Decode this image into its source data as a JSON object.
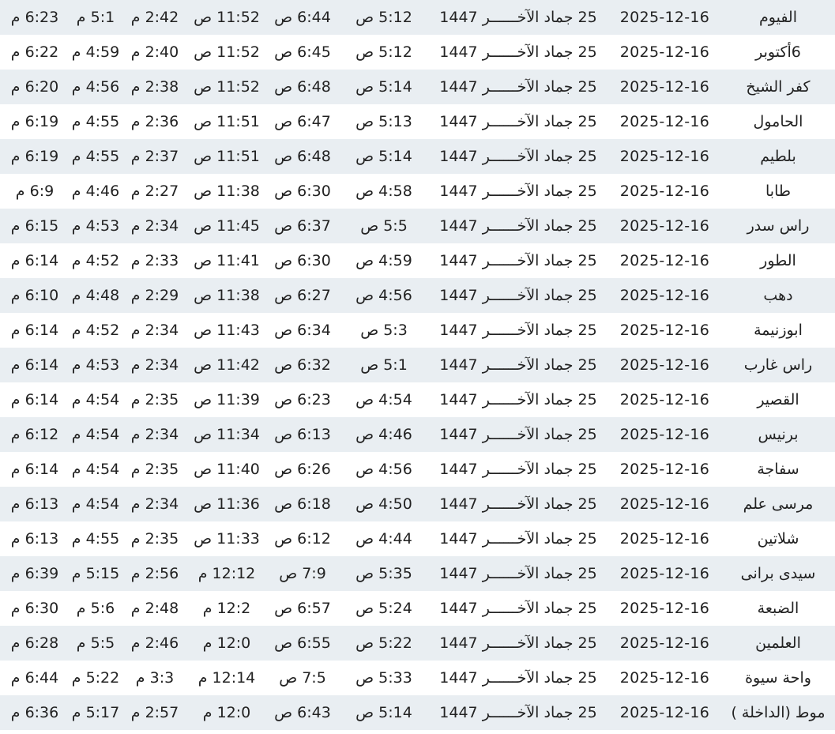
{
  "rows": [
    {
      "city": "الفيوم",
      "gregorian": "2025-12-16",
      "hijri": "25 جماد الآخــــــر 1447",
      "fajr": "5:12 ص",
      "sunrise": "6:44 ص",
      "dhuhr": "11:52 ص",
      "asr": "2:42 م",
      "maghrib": "5:1 م",
      "isha": "6:23 م"
    },
    {
      "city": "6أكتوبر",
      "gregorian": "2025-12-16",
      "hijri": "25 جماد الآخــــــر 1447",
      "fajr": "5:12 ص",
      "sunrise": "6:45 ص",
      "dhuhr": "11:52 ص",
      "asr": "2:40 م",
      "maghrib": "4:59 م",
      "isha": "6:22 م"
    },
    {
      "city": "كفر الشيخ",
      "gregorian": "2025-12-16",
      "hijri": "25 جماد الآخــــــر 1447",
      "fajr": "5:14 ص",
      "sunrise": "6:48 ص",
      "dhuhr": "11:52 ص",
      "asr": "2:38 م",
      "maghrib": "4:56 م",
      "isha": "6:20 م"
    },
    {
      "city": "الحامول",
      "gregorian": "2025-12-16",
      "hijri": "25 جماد الآخــــــر 1447",
      "fajr": "5:13 ص",
      "sunrise": "6:47 ص",
      "dhuhr": "11:51 ص",
      "asr": "2:36 م",
      "maghrib": "4:55 م",
      "isha": "6:19 م"
    },
    {
      "city": "بلطيم",
      "gregorian": "2025-12-16",
      "hijri": "25 جماد الآخــــــر 1447",
      "fajr": "5:14 ص",
      "sunrise": "6:48 ص",
      "dhuhr": "11:51 ص",
      "asr": "2:37 م",
      "maghrib": "4:55 م",
      "isha": "6:19 م"
    },
    {
      "city": "طابا",
      "gregorian": "2025-12-16",
      "hijri": "25 جماد الآخــــــر 1447",
      "fajr": "4:58 ص",
      "sunrise": "6:30 ص",
      "dhuhr": "11:38 ص",
      "asr": "2:27 م",
      "maghrib": "4:46 م",
      "isha": "6:9 م"
    },
    {
      "city": "راس سدر",
      "gregorian": "2025-12-16",
      "hijri": "25 جماد الآخــــــر 1447",
      "fajr": "5:5 ص",
      "sunrise": "6:37 ص",
      "dhuhr": "11:45 ص",
      "asr": "2:34 م",
      "maghrib": "4:53 م",
      "isha": "6:15 م"
    },
    {
      "city": "الطور",
      "gregorian": "2025-12-16",
      "hijri": "25 جماد الآخــــــر 1447",
      "fajr": "4:59 ص",
      "sunrise": "6:30 ص",
      "dhuhr": "11:41 ص",
      "asr": "2:33 م",
      "maghrib": "4:52 م",
      "isha": "6:14 م"
    },
    {
      "city": "دهب",
      "gregorian": "2025-12-16",
      "hijri": "25 جماد الآخــــــر 1447",
      "fajr": "4:56 ص",
      "sunrise": "6:27 ص",
      "dhuhr": "11:38 ص",
      "asr": "2:29 م",
      "maghrib": "4:48 م",
      "isha": "6:10 م"
    },
    {
      "city": "ابوزنيمة",
      "gregorian": "2025-12-16",
      "hijri": "25 جماد الآخــــــر 1447",
      "fajr": "5:3 ص",
      "sunrise": "6:34 ص",
      "dhuhr": "11:43 ص",
      "asr": "2:34 م",
      "maghrib": "4:52 م",
      "isha": "6:14 م"
    },
    {
      "city": "راس غارب",
      "gregorian": "2025-12-16",
      "hijri": "25 جماد الآخــــــر 1447",
      "fajr": "5:1 ص",
      "sunrise": "6:32 ص",
      "dhuhr": "11:42 ص",
      "asr": "2:34 م",
      "maghrib": "4:53 م",
      "isha": "6:14 م"
    },
    {
      "city": "القصير",
      "gregorian": "2025-12-16",
      "hijri": "25 جماد الآخــــــر 1447",
      "fajr": "4:54 ص",
      "sunrise": "6:23 ص",
      "dhuhr": "11:39 ص",
      "asr": "2:35 م",
      "maghrib": "4:54 م",
      "isha": "6:14 م"
    },
    {
      "city": "برنيس",
      "gregorian": "2025-12-16",
      "hijri": "25 جماد الآخــــــر 1447",
      "fajr": "4:46 ص",
      "sunrise": "6:13 ص",
      "dhuhr": "11:34 ص",
      "asr": "2:34 م",
      "maghrib": "4:54 م",
      "isha": "6:12 م"
    },
    {
      "city": "سفاجة",
      "gregorian": "2025-12-16",
      "hijri": "25 جماد الآخــــــر 1447",
      "fajr": "4:56 ص",
      "sunrise": "6:26 ص",
      "dhuhr": "11:40 ص",
      "asr": "2:35 م",
      "maghrib": "4:54 م",
      "isha": "6:14 م"
    },
    {
      "city": "مرسى علم",
      "gregorian": "2025-12-16",
      "hijri": "25 جماد الآخــــــر 1447",
      "fajr": "4:50 ص",
      "sunrise": "6:18 ص",
      "dhuhr": "11:36 ص",
      "asr": "2:34 م",
      "maghrib": "4:54 م",
      "isha": "6:13 م"
    },
    {
      "city": "شلاتين",
      "gregorian": "2025-12-16",
      "hijri": "25 جماد الآخــــــر 1447",
      "fajr": "4:44 ص",
      "sunrise": "6:12 ص",
      "dhuhr": "11:33 ص",
      "asr": "2:35 م",
      "maghrib": "4:55 م",
      "isha": "6:13 م"
    },
    {
      "city": "سيدى برانى",
      "gregorian": "2025-12-16",
      "hijri": "25 جماد الآخــــــر 1447",
      "fajr": "5:35 ص",
      "sunrise": "7:9 ص",
      "dhuhr": "12:12 م",
      "asr": "2:56 م",
      "maghrib": "5:15 م",
      "isha": "6:39 م"
    },
    {
      "city": "الضبعة",
      "gregorian": "2025-12-16",
      "hijri": "25 جماد الآخــــــر 1447",
      "fajr": "5:24 ص",
      "sunrise": "6:57 ص",
      "dhuhr": "12:2 م",
      "asr": "2:48 م",
      "maghrib": "5:6 م",
      "isha": "6:30 م"
    },
    {
      "city": "العلمين",
      "gregorian": "2025-12-16",
      "hijri": "25 جماد الآخــــــر 1447",
      "fajr": "5:22 ص",
      "sunrise": "6:55 ص",
      "dhuhr": "12:0 م",
      "asr": "2:46 م",
      "maghrib": "5:5 م",
      "isha": "6:28 م"
    },
    {
      "city": "واحة سيوة",
      "gregorian": "2025-12-16",
      "hijri": "25 جماد الآخــــــر 1447",
      "fajr": "5:33 ص",
      "sunrise": "7:5 ص",
      "dhuhr": "12:14 م",
      "asr": "3:3 م",
      "maghrib": "5:22 م",
      "isha": "6:44 م"
    },
    {
      "city": "موط (الداخلة )",
      "gregorian": "2025-12-16",
      "hijri": "25 جماد الآخــــــر 1447",
      "fajr": "5:14 ص",
      "sunrise": "6:43 ص",
      "dhuhr": "12:0 م",
      "asr": "2:57 م",
      "maghrib": "5:17 م",
      "isha": "6:36 م"
    }
  ]
}
